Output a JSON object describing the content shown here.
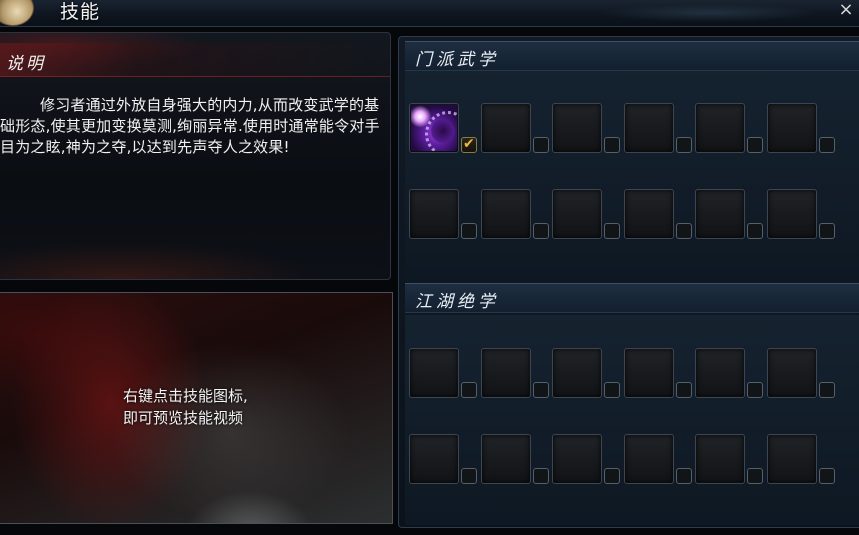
{
  "window": {
    "title": "技能",
    "close_label": "×"
  },
  "description": {
    "header": "说明",
    "text": "修习者通过外放自身强大的内力,从而改变武学的基础形态,使其更加变换莫测,绚丽异常.使用时通常能令对手目为之眩,神为之夺,以达到先声夺人之效果!"
  },
  "preview": {
    "hint_line1": "右键点击技能图标,",
    "hint_line2": "即可预览技能视频"
  },
  "sect_skills": {
    "header": "门派武学",
    "rows": 2,
    "cols": 6,
    "filled": [
      {
        "slot": 0,
        "icon": "purple-vortex-skill-icon",
        "checked": true
      }
    ]
  },
  "jianghu_skills": {
    "header": "江湖绝学",
    "rows": 2,
    "cols": 6,
    "filled": []
  },
  "colors": {
    "check_mark": "#f0b73c",
    "header_red": "#7a1919",
    "panel_blue": "#1e2e40"
  }
}
